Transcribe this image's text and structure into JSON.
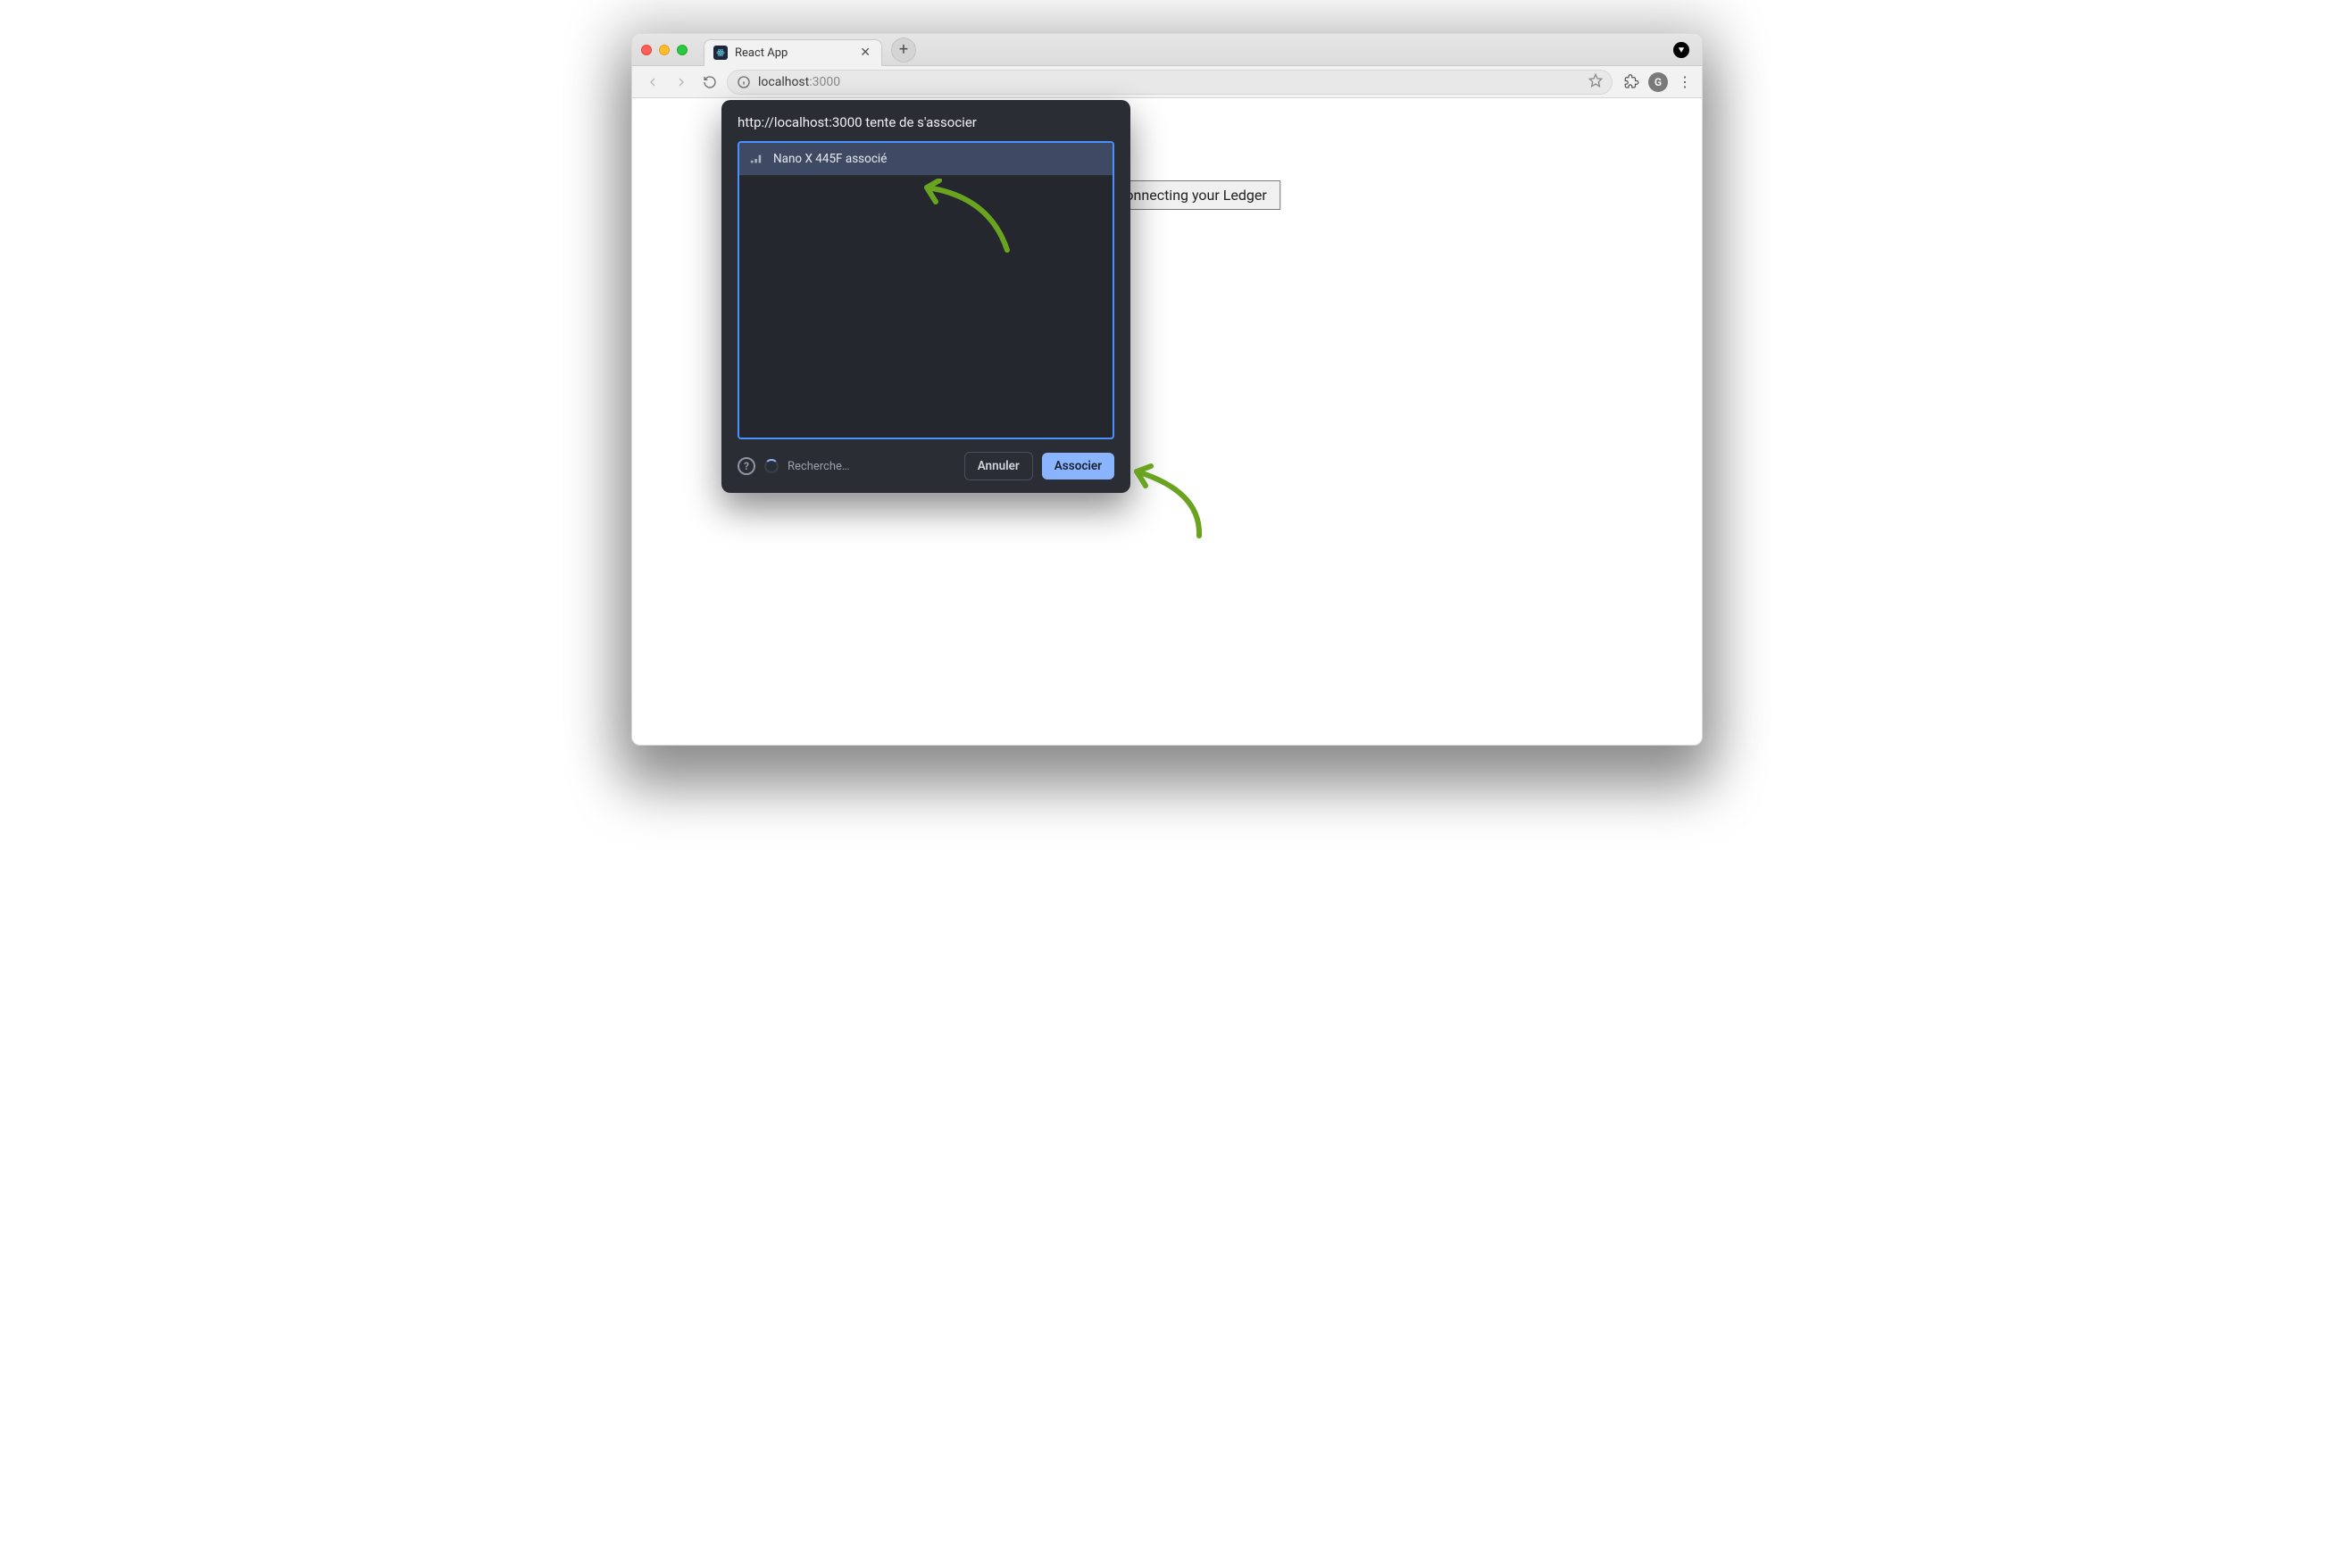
{
  "browser": {
    "tab_title": "React App",
    "url_host": "localhost",
    "url_port": ":3000",
    "avatar_initial": "G"
  },
  "page": {
    "button_label": "Click to connecting your Ledger"
  },
  "dialog": {
    "title": "http://localhost:3000 tente de s'associer",
    "device_name": "Nano X 445F associé",
    "searching_label": "Recherche…",
    "cancel_label": "Annuler",
    "pair_label": "Associer"
  }
}
